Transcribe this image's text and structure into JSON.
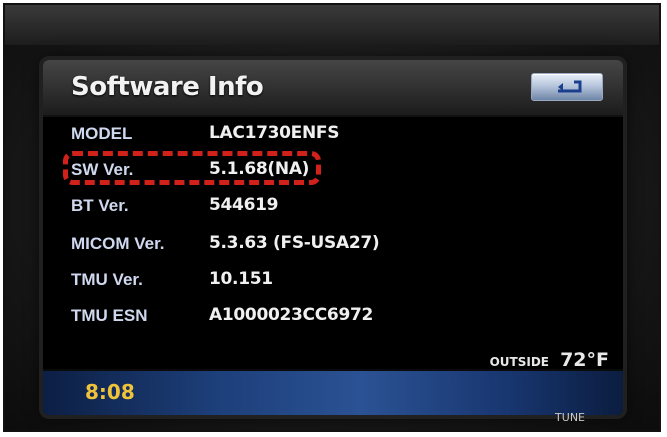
{
  "header": {
    "title": "Software Info",
    "back_icon": "back-arrow-icon"
  },
  "info_rows": [
    {
      "label": "MODEL",
      "value": "LAC1730ENFS"
    },
    {
      "label": "SW Ver.",
      "value": "5.1.68(NA)"
    },
    {
      "label": "BT Ver.",
      "value": "544619"
    },
    {
      "label": "MICOM Ver.",
      "value": "5.3.63 (FS-USA27)"
    },
    {
      "label": "TMU Ver.",
      "value": "10.151"
    },
    {
      "label": "TMU ESN",
      "value": "A1000023CC6972"
    }
  ],
  "status": {
    "clock": "8:08",
    "outside_label": "OUTSIDE",
    "outside_temp": "72°F"
  },
  "hardware": {
    "tune_label": "TUNE"
  },
  "colors": {
    "highlight": "#d0211a",
    "clock": "#f0c33a",
    "label": "#cfd8ee"
  }
}
